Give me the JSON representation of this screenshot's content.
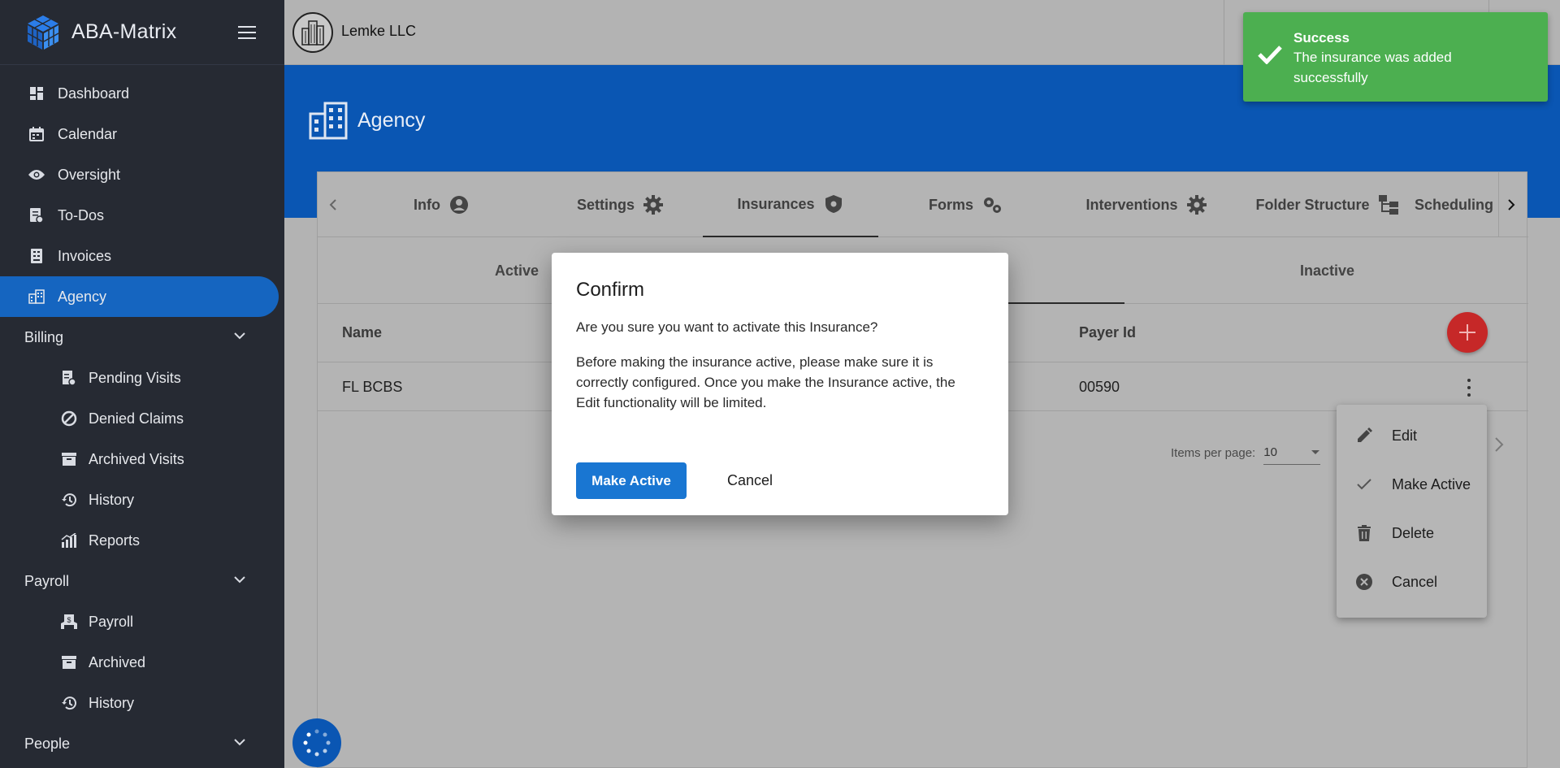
{
  "app": {
    "name": "ABA-Matrix"
  },
  "header": {
    "company": "Lemke LLC"
  },
  "sidebar": {
    "items": [
      {
        "label": "Dashboard"
      },
      {
        "label": "Calendar"
      },
      {
        "label": "Oversight"
      },
      {
        "label": "To-Dos"
      },
      {
        "label": "Invoices"
      },
      {
        "label": "Agency"
      }
    ],
    "billing": {
      "label": "Billing",
      "items": [
        {
          "label": "Pending Visits"
        },
        {
          "label": "Denied Claims"
        },
        {
          "label": "Archived Visits"
        },
        {
          "label": "History"
        },
        {
          "label": "Reports"
        }
      ]
    },
    "payroll": {
      "label": "Payroll",
      "items": [
        {
          "label": "Payroll"
        },
        {
          "label": "Archived"
        },
        {
          "label": "History"
        }
      ]
    },
    "people": {
      "label": "People"
    }
  },
  "page": {
    "title": "Agency"
  },
  "tabs": [
    {
      "label": "Info"
    },
    {
      "label": "Settings"
    },
    {
      "label": "Insurances"
    },
    {
      "label": "Forms"
    },
    {
      "label": "Interventions"
    },
    {
      "label": "Folder Structure"
    },
    {
      "label": "Scheduling"
    }
  ],
  "subtabs": {
    "active": "Active",
    "inactive": "Inactive"
  },
  "table": {
    "headers": {
      "name": "Name",
      "payer_id": "Payer Id"
    },
    "rows": [
      {
        "name": "FL BCBS",
        "payer_id": "00590"
      }
    ]
  },
  "paginator": {
    "label": "Items per page:",
    "value": "10"
  },
  "context_menu": {
    "items": [
      {
        "label": "Edit"
      },
      {
        "label": "Make Active"
      },
      {
        "label": "Delete"
      },
      {
        "label": "Cancel"
      }
    ]
  },
  "dialog": {
    "title": "Confirm",
    "question": "Are you sure you want to activate this Insurance?",
    "message": "Before making the insurance active, please make sure it is correctly configured. Once you make the Insurance active, the Edit functionality will be limited.",
    "confirm_label": "Make Active",
    "cancel_label": "Cancel"
  },
  "toast": {
    "title": "Success",
    "message": "The insurance was added successfully"
  },
  "colors": {
    "sidebar_bg": "#262a33",
    "accent": "#1565c0",
    "banner": "#0a56b3",
    "success": "#4caf50",
    "fab": "#c62828"
  }
}
